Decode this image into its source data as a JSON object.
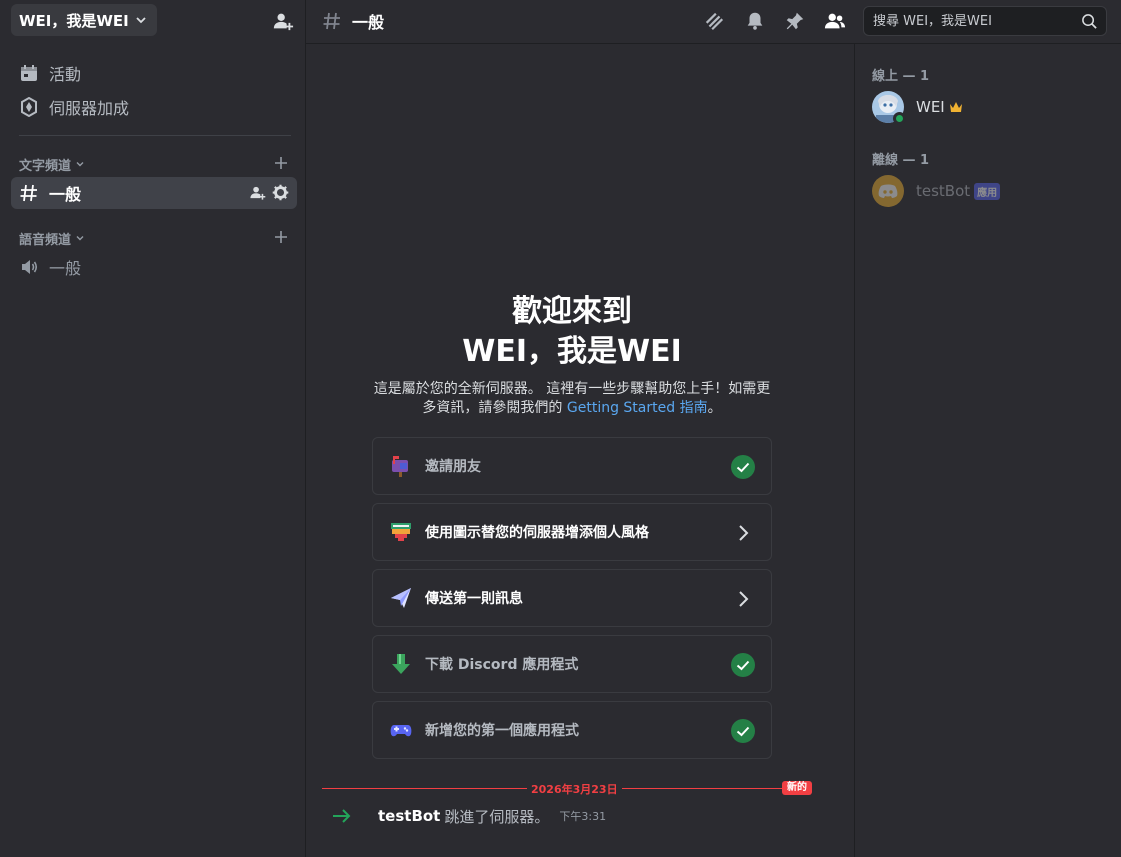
{
  "server": {
    "name": "WEI，我是WEI"
  },
  "sidebar": {
    "items": [
      {
        "label": "活動",
        "icon": "calendar-icon"
      },
      {
        "label": "伺服器加成",
        "icon": "boost-icon"
      }
    ],
    "text_category": "文字頻道",
    "text_channels": [
      {
        "name": "一般"
      }
    ],
    "voice_category": "語音頻道",
    "voice_channels": [
      {
        "name": "一般"
      }
    ]
  },
  "topbar": {
    "channel_name": "一般",
    "search_placeholder": "搜尋 WEI，我是WEI"
  },
  "welcome": {
    "title_line1": "歡迎來到",
    "title_line2": "WEI，我是WEI",
    "desc_prefix": "這是屬於您的全新伺服器。 這裡有一些步驟幫助您上手！如需更多資訊，請參閱我們的 ",
    "desc_link": "Getting Started 指南",
    "desc_suffix": "。"
  },
  "tasks": [
    {
      "label": "邀請朋友",
      "status": "done"
    },
    {
      "label": "使用圖示替您的伺服器增添個人風格",
      "status": "todo"
    },
    {
      "label": "傳送第一則訊息",
      "status": "todo"
    },
    {
      "label": "下載 Discord 應用程式",
      "status": "done"
    },
    {
      "label": "新增您的第一個應用程式",
      "status": "done"
    }
  ],
  "divider": {
    "date": "2026年3月23日",
    "new_label": "新的"
  },
  "system_message": {
    "user": "testBot",
    "text": "跳進了伺服器。",
    "time": "下午3:31"
  },
  "members": {
    "online_header": "線上 — 1",
    "offline_header": "離線 — 1",
    "online": [
      {
        "name": "WEI"
      }
    ],
    "offline": [
      {
        "name": "testBot",
        "badge": "應用"
      }
    ]
  },
  "colors": {
    "background": "#2b2b30",
    "active_channel": "#404249",
    "link": "#5aa7f0",
    "new_red": "#f23f43",
    "online_green": "#23a55a",
    "check_green": "#248046",
    "blurple": "#5865f2"
  }
}
